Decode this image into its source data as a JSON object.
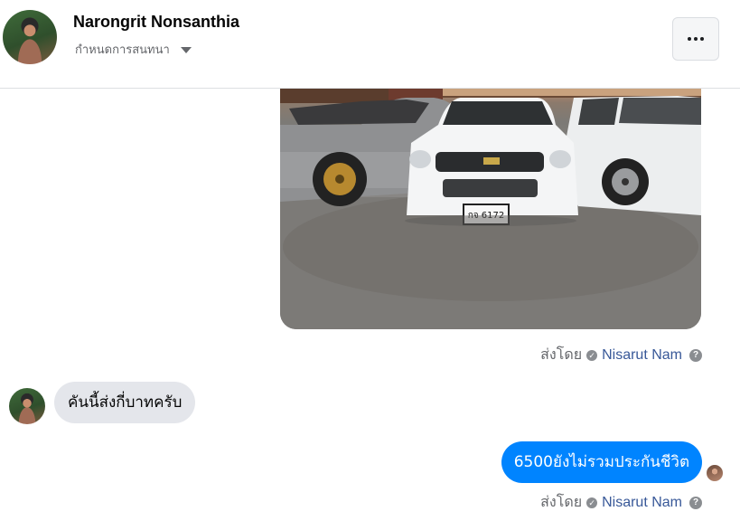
{
  "header": {
    "contact_name": "Narongrit Nonsanthia",
    "manage_label": "กำหนดการสนทนา",
    "more_label": "More options"
  },
  "messages": [
    {
      "type": "image",
      "direction": "outgoing",
      "plate_text": "กจ 6172",
      "sent_by_label": "ส่งโดย",
      "sender": "Nisarut Nam"
    },
    {
      "type": "text",
      "direction": "incoming",
      "text": "คันนี้ส่งกี่บาทครับ"
    },
    {
      "type": "text",
      "direction": "outgoing",
      "text": "6500ยังไม่รวมประกันชีวิต",
      "sent_by_label": "ส่งโดย",
      "sender": "Nisarut Nam"
    }
  ],
  "colors": {
    "outgoing_bubble": "#0084ff",
    "incoming_bubble": "#e4e6eb",
    "sender_link": "#385898",
    "meta_text": "#65676b"
  },
  "icons": {
    "verified": "check-circle-icon",
    "help": "question-circle-icon",
    "caret": "caret-down-icon",
    "more": "ellipsis-icon"
  }
}
